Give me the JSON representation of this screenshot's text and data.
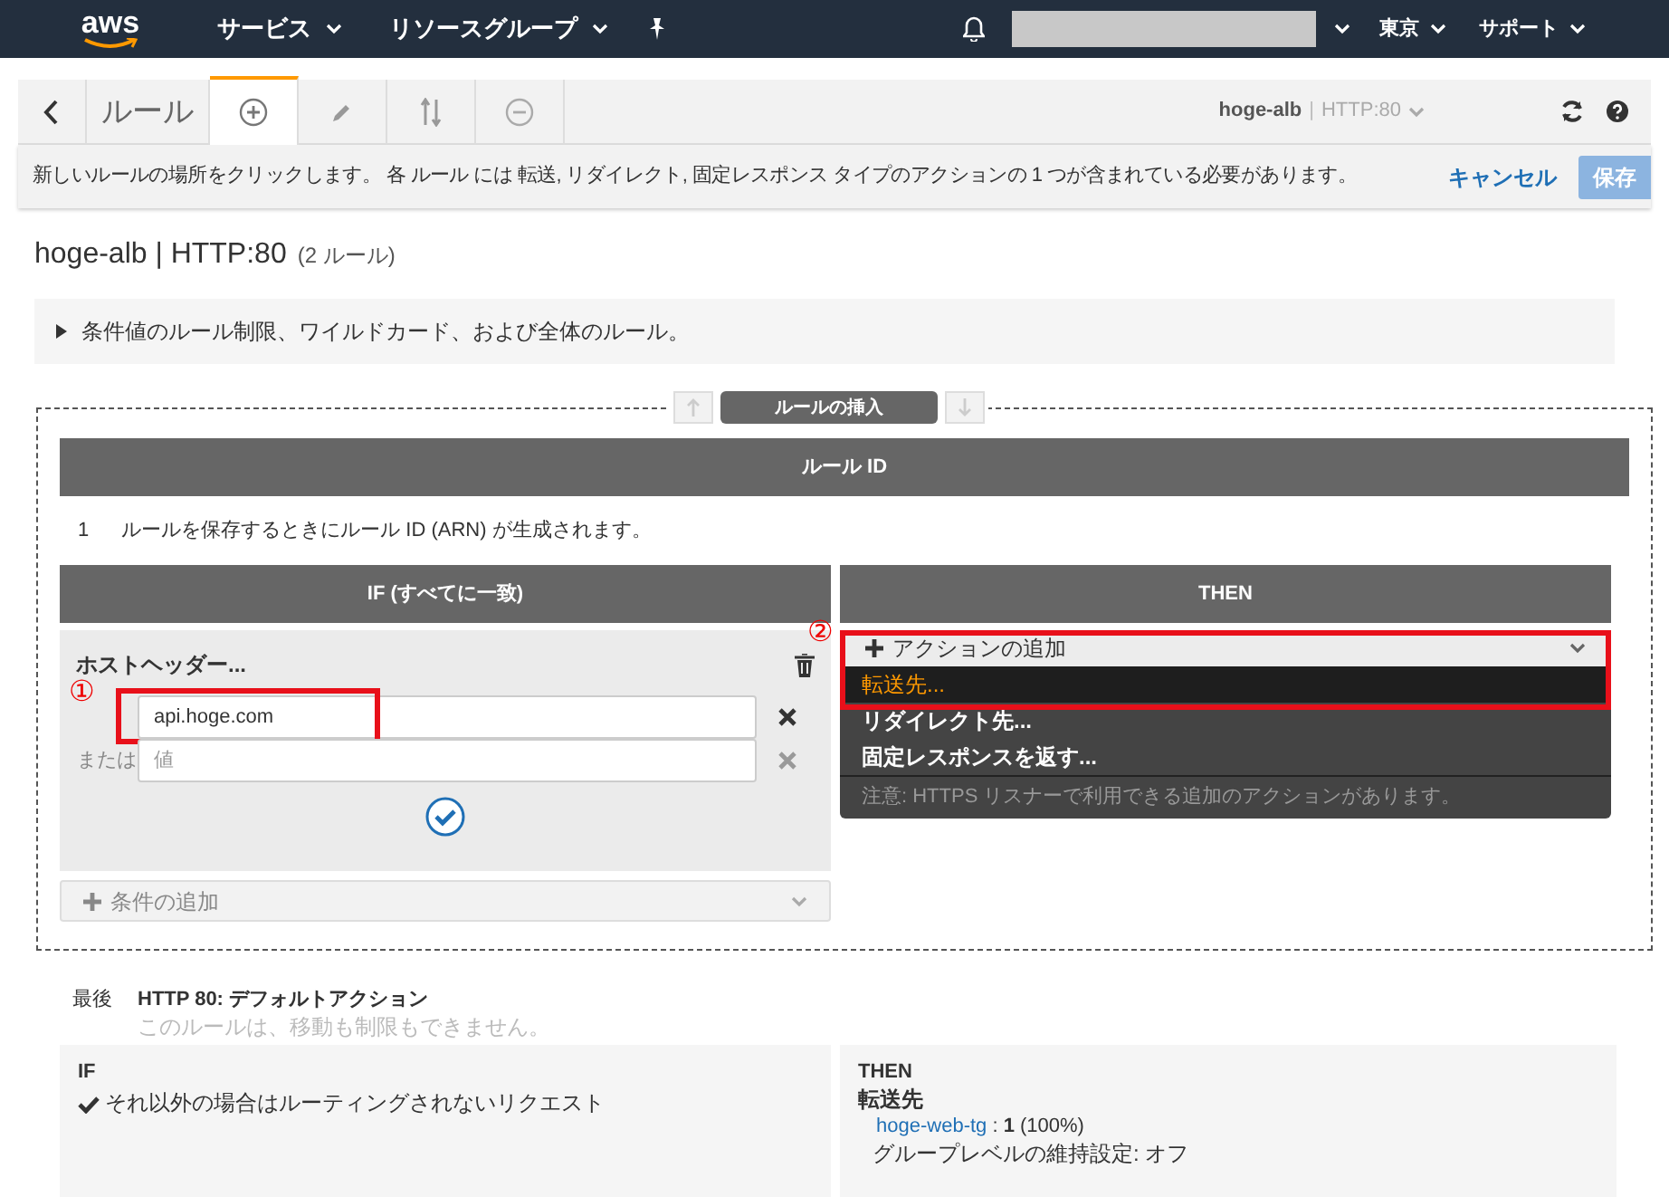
{
  "top_nav": {
    "logo": "aws",
    "menus": [
      {
        "label": "サービス"
      },
      {
        "label": "リソースグループ"
      }
    ],
    "region": "東京",
    "support": "サポート"
  },
  "toolbar": {
    "tabs": [
      {
        "kind": "text",
        "label": "ルール",
        "selected": false
      },
      {
        "kind": "add",
        "selected": true
      },
      {
        "kind": "edit",
        "selected": false
      },
      {
        "kind": "reorder",
        "selected": false
      },
      {
        "kind": "delete",
        "selected": false
      }
    ],
    "listener": {
      "name": "hoge-alb",
      "separator": "|",
      "port": "HTTP:80"
    }
  },
  "info_bar": {
    "message": "新しいルールの場所をクリックします。 各 ルール には 転送, リダイレクト, 固定レスポンス タイプのアクションの 1 つが含まれている必要があります。",
    "cancel": "キャンセル",
    "save": "保存"
  },
  "heading": {
    "title": "hoge-alb | HTTP:80",
    "count": "(2 ルール)"
  },
  "expander": {
    "label": "条件値のルール制限、ワイルドカード、および全体のルール。",
    "expanded": false
  },
  "insert_label": "ルールの挿入",
  "rule_id_header": "ルール ID",
  "rule": {
    "number": "1",
    "note": "ルールを保存するときにルール ID (ARN) が生成されます。"
  },
  "if_header": "IF (すべてに一致)",
  "then_header": "THEN",
  "condition": {
    "title": "ホストヘッダー...",
    "values": [
      {
        "value": "api.hoge.com",
        "annotation": "①"
      },
      {
        "prefix": "または",
        "placeholder": "値"
      }
    ]
  },
  "add_condition": "条件の追加",
  "action_menu": {
    "button": "アクションの追加",
    "annotation": "②",
    "options": [
      {
        "label": "転送先...",
        "selected": true
      },
      {
        "label": "リダイレクト先...",
        "selected": false
      },
      {
        "label": "固定レスポンスを返す...",
        "selected": false
      }
    ],
    "note": "注意: HTTPS リスナーで利用できる追加のアクションがあります。"
  },
  "default_rule": {
    "position": "最後",
    "title": "HTTP 80: デフォルトアクション",
    "subtitle": "このルールは、移動も制限もできません。",
    "if_label": "IF",
    "if_text": "それ以外の場合はルーティングされないリクエスト",
    "then_label": "THEN",
    "action": "転送先",
    "target": "hoge-web-tg",
    "weight": " : **1** (100%)",
    "stickiness": "グループレベルの維持設定: オフ"
  }
}
